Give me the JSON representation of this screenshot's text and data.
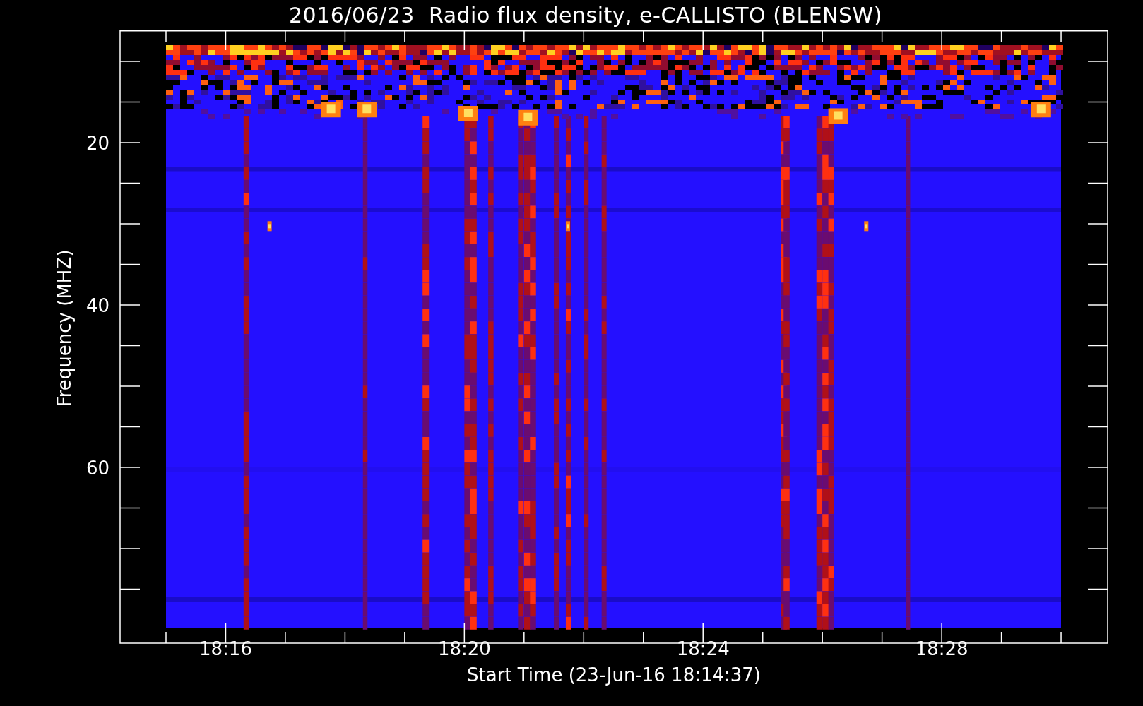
{
  "title": "2016/06/23  Radio flux density, e-CALLISTO (BLENSW)",
  "y_axis": {
    "label": "Frequency (MHZ)",
    "ticks": [
      "20",
      "40",
      "60"
    ]
  },
  "x_axis": {
    "label": "Start Time (23-Jun-16 18:14:37)",
    "ticks": [
      "18:16",
      "18:20",
      "18:24",
      "18:28"
    ]
  }
}
